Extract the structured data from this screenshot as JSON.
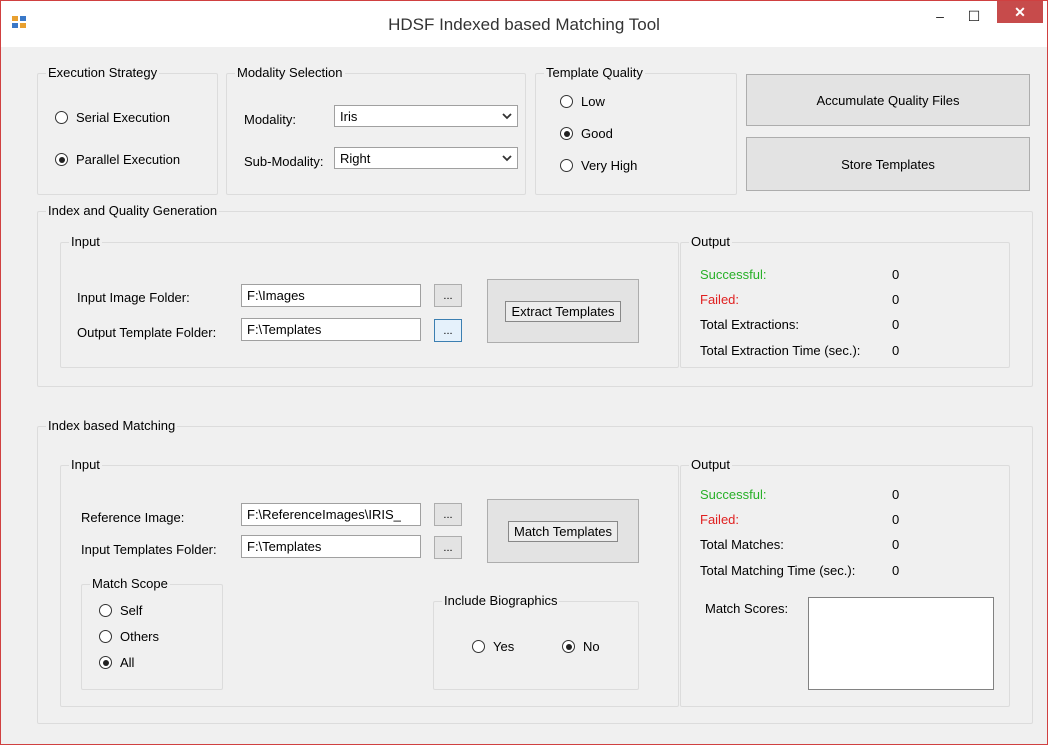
{
  "window": {
    "title": "HDSF Indexed based Matching Tool",
    "minimize": "–",
    "maximize": "☐",
    "close": "✕"
  },
  "execution_strategy": {
    "title": "Execution Strategy",
    "options": [
      {
        "label": "Serial Execution",
        "checked": false
      },
      {
        "label": "Parallel Execution",
        "checked": true
      }
    ]
  },
  "modality_selection": {
    "title": "Modality Selection",
    "modality_label": "Modality:",
    "modality_value": "Iris",
    "submodality_label": "Sub-Modality:",
    "submodality_value": "Right"
  },
  "template_quality": {
    "title": "Template Quality",
    "options": [
      {
        "label": "Low",
        "checked": false
      },
      {
        "label": "Good",
        "checked": true
      },
      {
        "label": "Very High",
        "checked": false
      }
    ]
  },
  "buttons": {
    "accumulate": "Accumulate Quality Files",
    "store": "Store Templates"
  },
  "index_quality": {
    "title": "Index and Quality Generation",
    "input": {
      "title": "Input",
      "image_folder_label": "Input Image Folder:",
      "image_folder_value": "F:\\Images",
      "template_folder_label": "Output Template Folder:",
      "template_folder_value": "F:\\Templates",
      "browse": "...",
      "extract_button": "Extract Templates"
    },
    "output": {
      "title": "Output",
      "successful_label": "Successful:",
      "successful_value": "0",
      "failed_label": "Failed:",
      "failed_value": "0",
      "total_label": "Total Extractions:",
      "total_value": "0",
      "time_label": "Total Extraction Time (sec.):",
      "time_value": "0"
    }
  },
  "index_matching": {
    "title": "Index based Matching",
    "input": {
      "title": "Input",
      "reference_label": "Reference Image:",
      "reference_value": "F:\\ReferenceImages\\IRIS_",
      "templates_label": "Input Templates Folder:",
      "templates_value": "F:\\Templates",
      "browse": "...",
      "match_button": "Match Templates",
      "match_scope": {
        "title": "Match Scope",
        "options": [
          {
            "label": "Self",
            "checked": false
          },
          {
            "label": "Others",
            "checked": false
          },
          {
            "label": "All",
            "checked": true
          }
        ]
      },
      "biographics": {
        "title": "Include Biographics",
        "options": [
          {
            "label": "Yes",
            "checked": false
          },
          {
            "label": "No",
            "checked": true
          }
        ]
      }
    },
    "output": {
      "title": "Output",
      "successful_label": "Successful:",
      "successful_value": "0",
      "failed_label": "Failed:",
      "failed_value": "0",
      "total_label": "Total Matches:",
      "total_value": "0",
      "time_label": "Total Matching Time (sec.):",
      "time_value": "0",
      "scores_label": "Match Scores:"
    }
  }
}
